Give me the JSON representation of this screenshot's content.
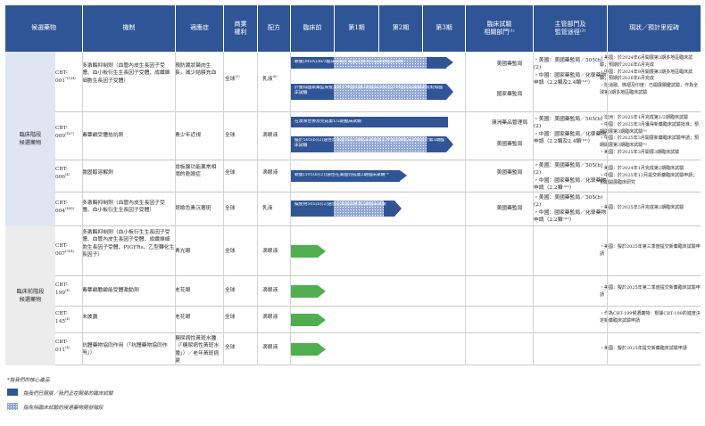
{
  "headers": {
    "candidate": "候選藥物",
    "mechanism": "機制",
    "indication": "適應症",
    "rights": "商業\n權利",
    "formulation": "配方",
    "preclinical": "臨床前",
    "phase1": "第1期",
    "phase2": "第2期",
    "phase3": "第3期",
    "trial_dept": "臨床試驗\n相關部門⁽¹⁾",
    "regulator": "主管部門及\n監管途徑⁽²⁾",
    "status": "現狀／預計里程碑"
  },
  "groups": {
    "clinical": "臨床階段\n候選藥物",
    "preclinical": "臨床前階段\n候選藥物"
  },
  "rows": [
    {
      "code": "CBT-\n001",
      "code_sup": "*(3)(4)",
      "mechanism": "多激酶抑制劑（血管內皮生長因子受體、血小板衍生生長因子受體、成纖維細胞生長因子受體）",
      "indication": "預防翼狀胬肉生長，減少結膜充血",
      "rights": "全球",
      "rights_sup": "(5)",
      "formulation": "乳液",
      "formulation_sup": "(6)",
      "bar1": "軟膜(MSA)3b/3臨床試驗於美國及歐洲完成關鍵臨床試驗",
      "bar2": "於獲得國家藥監局批准後於中國開展3期臨床試驗並於中國完成關鍵期及對照臨床試驗",
      "dept": [
        "美國藥監局",
        "國家藥監局"
      ],
      "regulator": "・美國：美國藥監局／505(b)(2)\n・中國：國家藥監局／化學藥物申請（2.2類及2.4類⁽¹⁰⁾）",
      "status": "・美國：於2024年6月開展第3期多地區臨床試驗；預期於2026年6月完成\n・中國：於2024年9月開展第3期多地區臨床試驗；預期於2026年6月完成\n・陸消融、微褶及印度：已開展關鍵試驗，作為全球第3期多地區臨床試驗"
    },
    {
      "code": "CBT-\n009",
      "code_sup": "(4)(7)",
      "mechanism": "毒蕈鹼受體拮抗劑",
      "indication": "青少年近視",
      "rights": "全球",
      "formulation": "滴眼液",
      "bar1": "在澳洲合併及完成第1/2期臨床試驗",
      "bar2": "擬於505(b)(2)途徑於美國完成3期臨床試驗並於中國開展臨床試驗並於第3期臨床試驗",
      "dept": [
        "澳洲藥品管理局",
        "美國藥監局"
      ],
      "regulator": "・美國：美國藥監局／505(b)(2)\n・中國：國家藥監局／化學藥物申請（2.2類及2.4類⁽¹⁰⁾）",
      "status": "・澳洲：於2025年1月完成第1/2期臨床試驗\n・中國：於2025年3月獲得新藥臨床試驗批准；預期開展第3期臨床試驗⁽⁹⁾\n・中國：於2025年3月開展新藥臨床試驗申請；預期開展第3期臨床試驗⁽⁹⁾\n・美國：於2025年3月開展3期臨床試驗"
    },
    {
      "code": "CBT-\n006",
      "code_sup": "(4)",
      "mechanism": "膽固醇溶解劑",
      "indication": "瞼板腺功能異常相關的乾眼症",
      "rights": "全球",
      "formulation": "滴眼液",
      "bar1": "軟膜(505(b)(2))途徑在美國完成第2期臨床試驗⁽⁹⁾",
      "dept": [
        "美國藥監局"
      ],
      "regulator": "・美國：美國藥監局／505(b)(2)\n・中國：國家藥監局／化學藥物申請（2.2類⁽¹⁰⁾）",
      "status": "・美國：於2024年1月完成第2期臨床試驗\n・中國：於2025年12月提交新藥臨床試驗申請；預期開展臨床研究"
    },
    {
      "code": "CBT-\n004",
      "code_sup": "(4)(8)",
      "mechanism": "多激酶抑制劑（血管內皮生長因子受體、血小板衍生生長因子受體）",
      "indication": "眼瞼色素沉著斑",
      "rights": "全球",
      "formulation": "乳液",
      "bar1": "擬使用505(b)(2)途徑在美國開展第2期臨床試驗",
      "dept": [
        "美國藥監局"
      ],
      "regulator": "・美國：美國藥監局／505(b)(2)\n・中國：國家藥監局／化學藥物申請（2.2類⁽¹⁰⁾）",
      "status": "・美國：於2025年5月完成第2期臨床試驗"
    },
    {
      "code": "CBT-\n007",
      "code_sup": "(3)(4)",
      "mechanism": "多激酶抑制劑（血小板衍生生長因子受體、血管內皮生長因子受體、成纖維細胞生長因子受體、PIGFRs、乙型轉化生長因子）",
      "indication": "青光眼",
      "rights": "全球",
      "formulation": "滴眼液",
      "status": "・美國：擬於2025年第三季度提交新藥臨床試驗申請"
    },
    {
      "code": "CBT-\n199",
      "code_sup": "(4)",
      "mechanism": "毒蕈鹼膽鹼能受體激動劑",
      "indication": "老花眼",
      "rights": "全球",
      "formulation": "滴眼液",
      "status": "・美國：擬於2025年第二季度提交新藥臨床試驗申請"
    },
    {
      "code": "CBT-\n145",
      "code_sup": "(4)",
      "mechanism": "未披露",
      "indication": "老花眼",
      "rights": "全球",
      "formulation": "滴眼液",
      "status": "・作為CBT-199候選藥物：根據CBT-199的進度決定新藥臨床試驗申請"
    },
    {
      "code": "CBT-\n011",
      "code_sup": "(4)",
      "mechanism": "抗體藥物協同作用（「抗體藥物協同作用」）",
      "indication": "糖尿病性黃斑水腫（「糖尿病性黃斑水腫」）／老年黃斑病變",
      "rights": "全球",
      "formulation": "滴眼液",
      "status": "・美國：擬於2025年提交新藥臨床試驗申請"
    }
  ],
  "footer": {
    "note": "*指我們的核心產品",
    "legend_solid": "指我們已開展／我們正在開展的臨床試驗",
    "legend_dots": "指免除臨床試驗的候選藥物開發階段"
  },
  "colors": {
    "header_bg": "#2f5597",
    "bar_solid": "#2f5597",
    "bar_dots": "#8fa6d6",
    "preclinical_green": "#4faf4f"
  }
}
